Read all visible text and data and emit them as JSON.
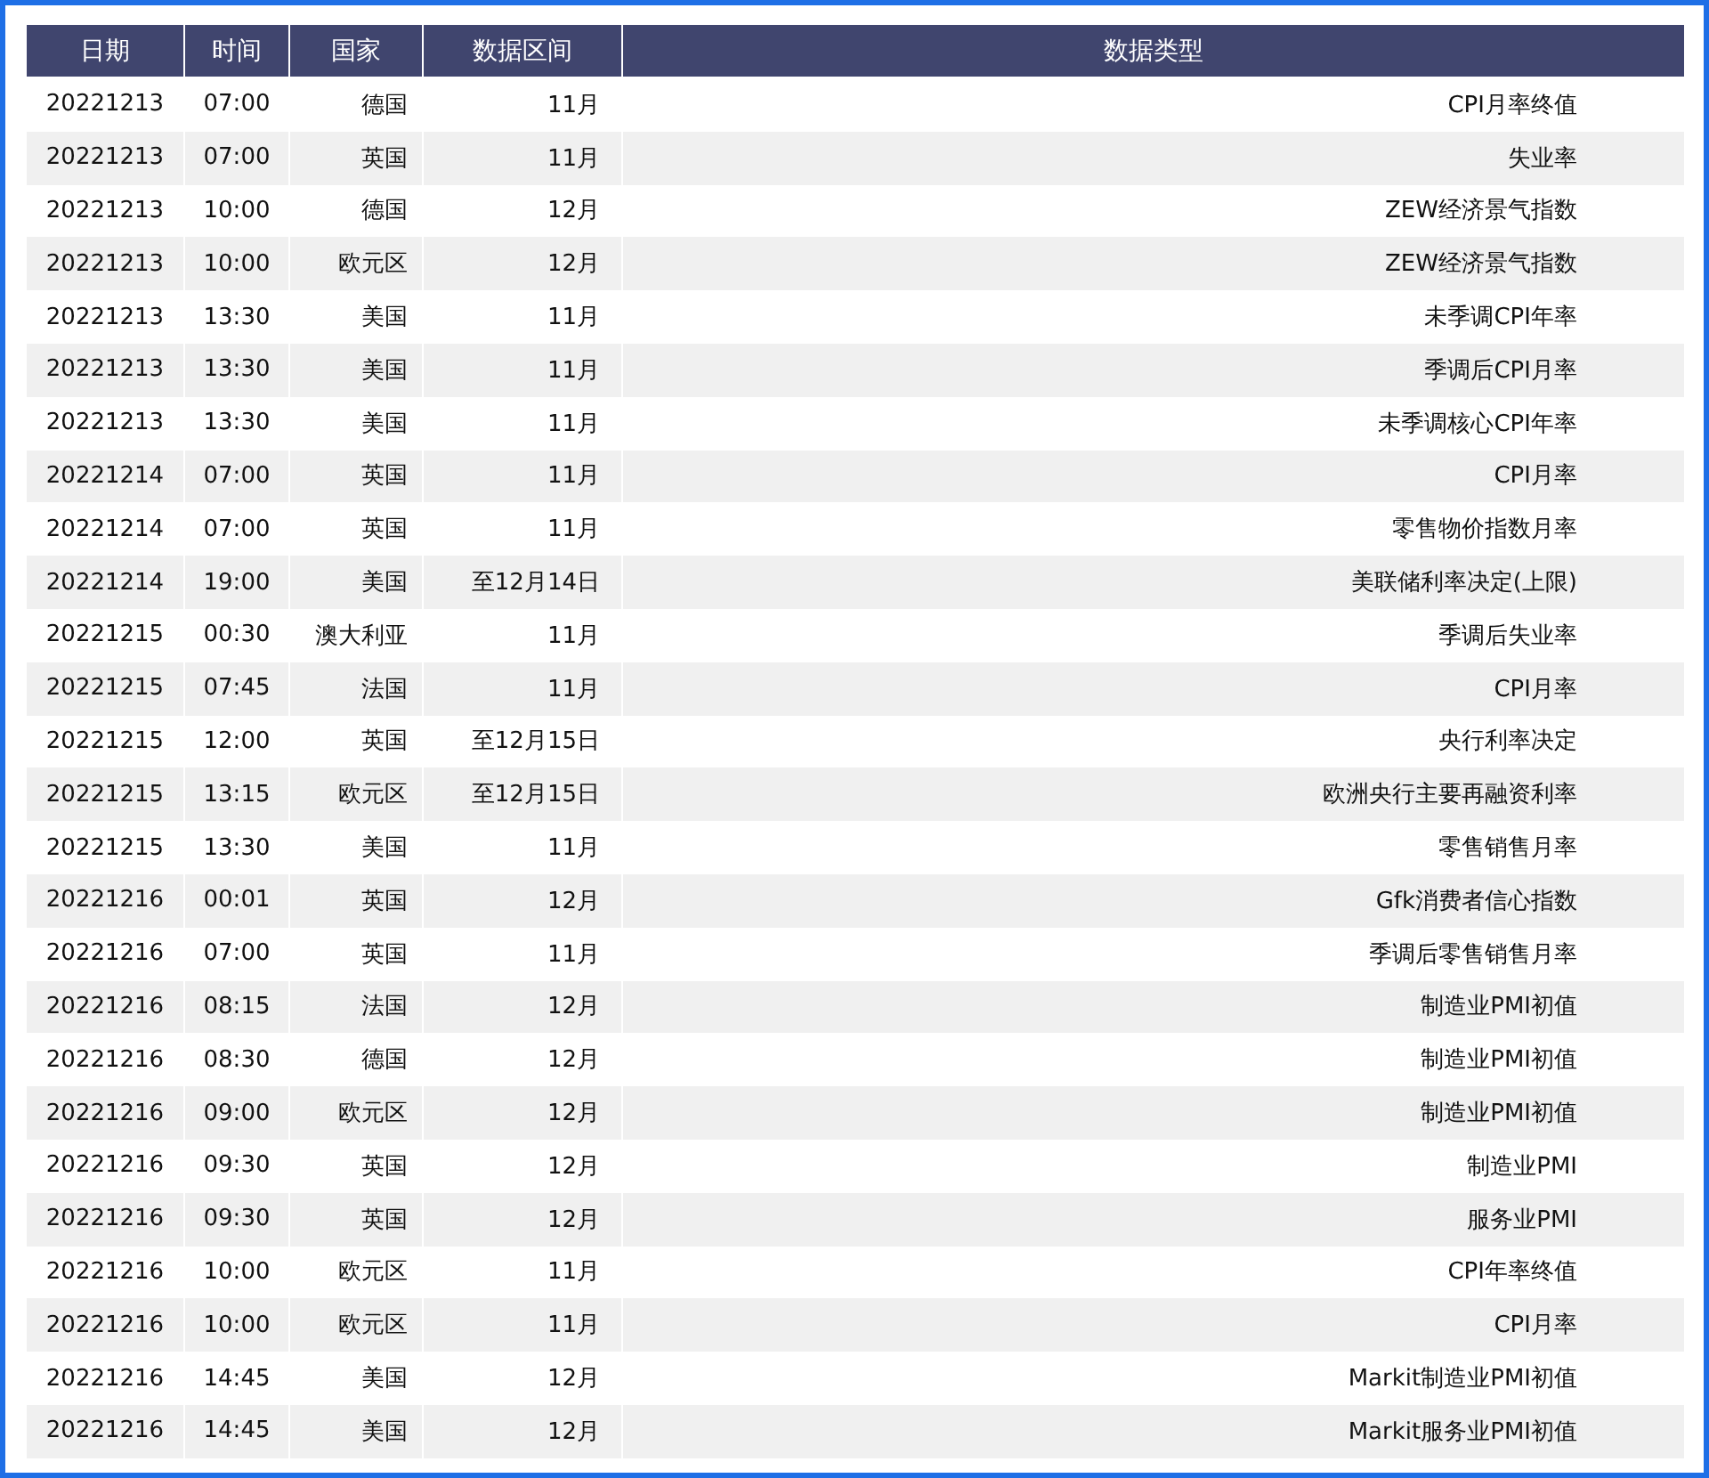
{
  "table": {
    "columns": [
      "日期",
      "时间",
      "国家",
      "数据区间",
      "数据类型"
    ],
    "rows": [
      [
        "20221213",
        "07:00",
        "德国",
        "11月",
        "CPI月率终值"
      ],
      [
        "20221213",
        "07:00",
        "英国",
        "11月",
        "失业率"
      ],
      [
        "20221213",
        "10:00",
        "德国",
        "12月",
        "ZEW经济景气指数"
      ],
      [
        "20221213",
        "10:00",
        "欧元区",
        "12月",
        "ZEW经济景气指数"
      ],
      [
        "20221213",
        "13:30",
        "美国",
        "11月",
        "未季调CPI年率"
      ],
      [
        "20221213",
        "13:30",
        "美国",
        "11月",
        "季调后CPI月率"
      ],
      [
        "20221213",
        "13:30",
        "美国",
        "11月",
        "未季调核心CPI年率"
      ],
      [
        "20221214",
        "07:00",
        "英国",
        "11月",
        "CPI月率"
      ],
      [
        "20221214",
        "07:00",
        "英国",
        "11月",
        "零售物价指数月率"
      ],
      [
        "20221214",
        "19:00",
        "美国",
        "至12月14日",
        "美联储利率决定(上限)"
      ],
      [
        "20221215",
        "00:30",
        "澳大利亚",
        "11月",
        "季调后失业率"
      ],
      [
        "20221215",
        "07:45",
        "法国",
        "11月",
        "CPI月率"
      ],
      [
        "20221215",
        "12:00",
        "英国",
        "至12月15日",
        "央行利率决定"
      ],
      [
        "20221215",
        "13:15",
        "欧元区",
        "至12月15日",
        "欧洲央行主要再融资利率"
      ],
      [
        "20221215",
        "13:30",
        "美国",
        "11月",
        "零售销售月率"
      ],
      [
        "20221216",
        "00:01",
        "英国",
        "12月",
        "Gfk消费者信心指数"
      ],
      [
        "20221216",
        "07:00",
        "英国",
        "11月",
        "季调后零售销售月率"
      ],
      [
        "20221216",
        "08:15",
        "法国",
        "12月",
        "制造业PMI初值"
      ],
      [
        "20221216",
        "08:30",
        "德国",
        "12月",
        "制造业PMI初值"
      ],
      [
        "20221216",
        "09:00",
        "欧元区",
        "12月",
        "制造业PMI初值"
      ],
      [
        "20221216",
        "09:30",
        "英国",
        "12月",
        "制造业PMI"
      ],
      [
        "20221216",
        "09:30",
        "英国",
        "12月",
        "服务业PMI"
      ],
      [
        "20221216",
        "10:00",
        "欧元区",
        "11月",
        "CPI年率终值"
      ],
      [
        "20221216",
        "10:00",
        "欧元区",
        "11月",
        "CPI月率"
      ],
      [
        "20221216",
        "14:45",
        "美国",
        "12月",
        "Markit制造业PMI初值"
      ],
      [
        "20221216",
        "14:45",
        "美国",
        "12月",
        "Markit服务业PMI初值"
      ]
    ]
  }
}
